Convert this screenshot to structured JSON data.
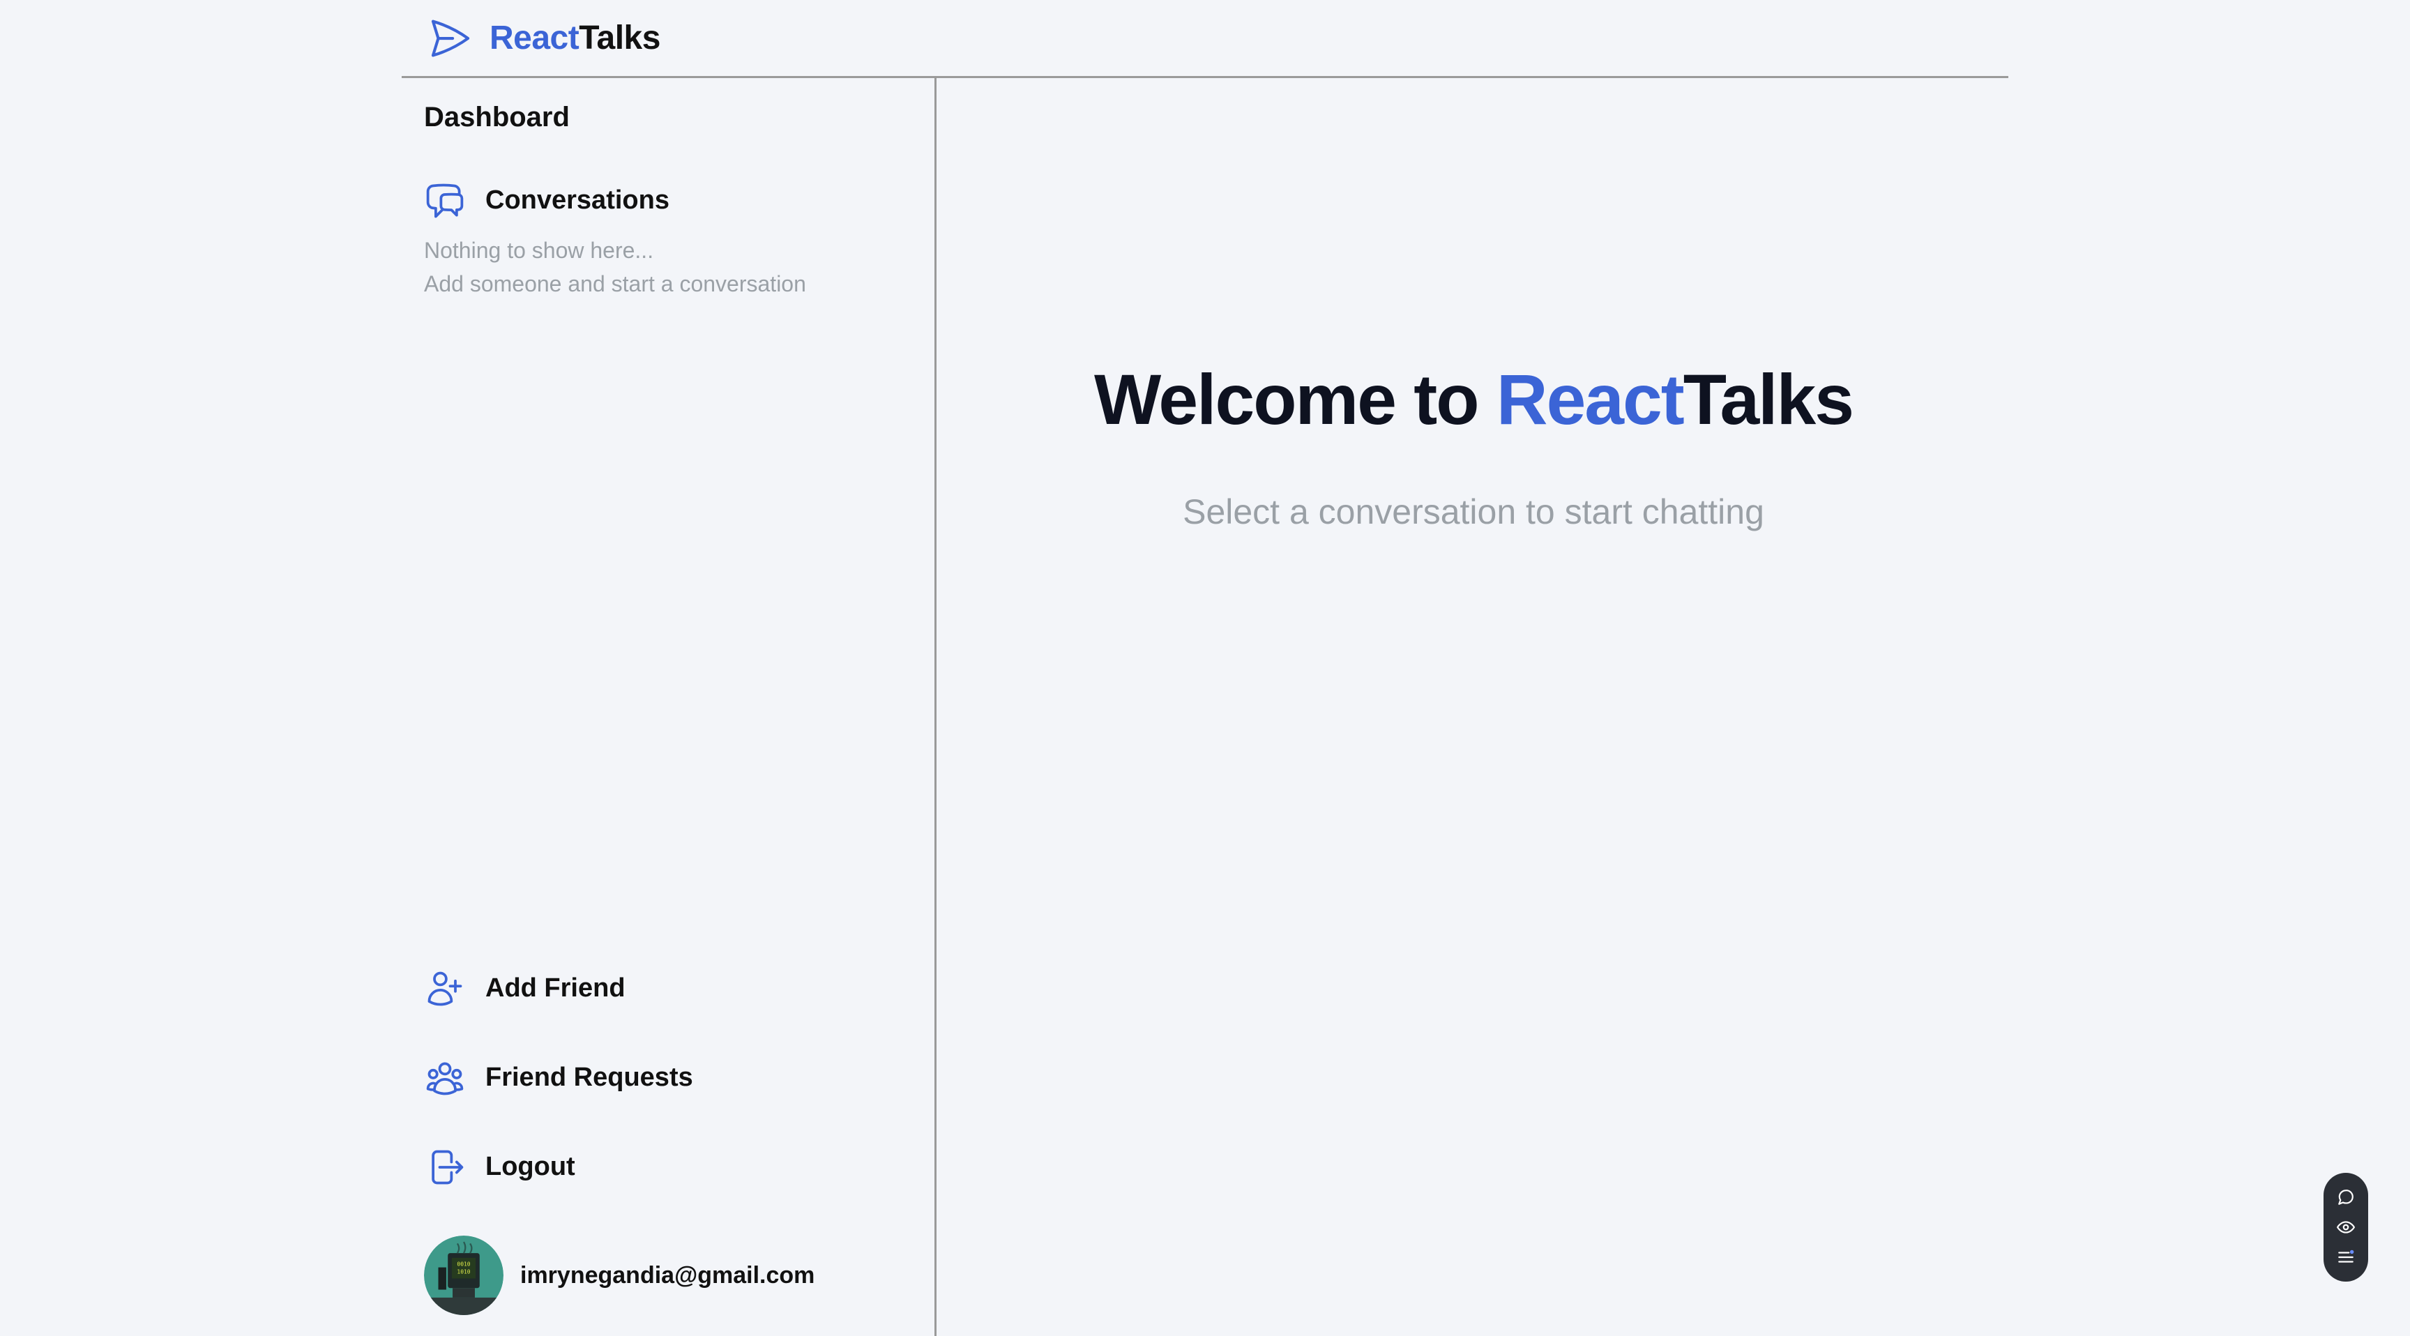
{
  "header": {
    "brand_accent": "React",
    "brand_rest": "Talks",
    "logo_icon": "paper-plane-icon"
  },
  "sidebar": {
    "title": "Dashboard",
    "conversations": {
      "label": "Conversations",
      "icon": "chat-bubbles-icon",
      "empty_line_1": "Nothing to show here...",
      "empty_line_2": "Add someone and start a conversation"
    },
    "nav": [
      {
        "label": "Add Friend",
        "icon": "user-plus-icon"
      },
      {
        "label": "Friend Requests",
        "icon": "users-icon"
      },
      {
        "label": "Logout",
        "icon": "logout-icon"
      }
    ],
    "user": {
      "email": "imrynegandia@gmail.com",
      "avatar": "avatar-image"
    }
  },
  "main": {
    "welcome_prefix": "Welcome to ",
    "welcome_accent": "React",
    "welcome_rest": "Talks",
    "subtitle": "Select a conversation to start chatting"
  },
  "widget": {
    "buttons": [
      "chat-icon",
      "eye-icon",
      "list-icon"
    ]
  },
  "colors": {
    "accent": "#3b64d6",
    "background": "#f3f5f9",
    "muted_text": "#9aa0a6",
    "border": "#9a9a9a"
  }
}
